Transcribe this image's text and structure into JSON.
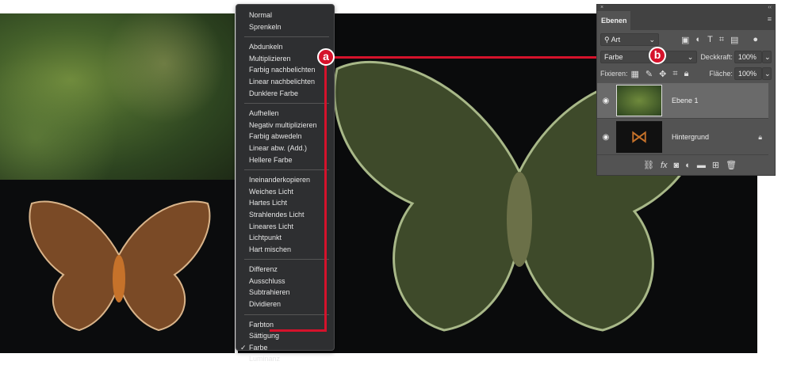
{
  "menu": {
    "items": [
      [
        "Normal",
        "Sprenkeln"
      ],
      [
        "Abdunkeln",
        "Multiplizieren",
        "Farbig nachbelichten",
        "Linear nachbelichten",
        "Dunklere Farbe"
      ],
      [
        "Aufhellen",
        "Negativ multiplizieren",
        "Farbig abwedeln",
        "Linear abw. (Add.)",
        "Hellere Farbe"
      ],
      [
        "Ineinanderkopieren",
        "Weiches Licht",
        "Hartes Licht",
        "Strahlendes Licht",
        "Lineares Licht",
        "Lichtpunkt",
        "Hart mischen"
      ],
      [
        "Differenz",
        "Ausschluss",
        "Subtrahieren",
        "Dividieren"
      ],
      [
        "Farbton",
        "Sättigung",
        "Farbe",
        "Luminanz"
      ]
    ],
    "checked": "Farbe",
    "checkmark": "✓"
  },
  "panel": {
    "close": "×",
    "collapse": "‹‹",
    "tab": "Ebenen",
    "filter": "Art",
    "blend_mode": "Farbe",
    "opacity_label": "Deckkraft:",
    "opacity": "100%",
    "lock_label": "Fixieren:",
    "fill_label": "Fläche:",
    "fill": "100%",
    "layers": [
      {
        "name": "Ebene 1"
      },
      {
        "name": "Hintergrund"
      }
    ],
    "fx": "fx"
  },
  "callouts": {
    "a": "a",
    "b": "b"
  },
  "colors": {
    "accent": "#d5122b"
  }
}
